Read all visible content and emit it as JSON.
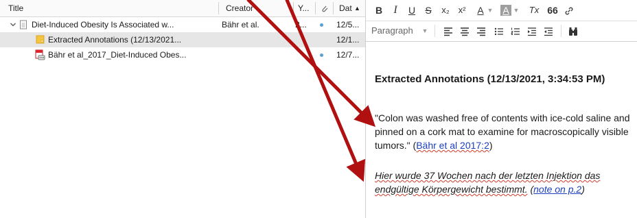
{
  "columns": {
    "title": "Title",
    "creator": "Creator",
    "year": "Y...",
    "date": "Dat"
  },
  "rows": [
    {
      "title": "Diet-Induced Obesity Is Associated w...",
      "creator": "Bähr et al.",
      "year": "2...",
      "date": "12/5..."
    },
    {
      "title": "Extracted Annotations (12/13/2021...",
      "creator": "",
      "year": "",
      "date": "12/1..."
    },
    {
      "title": "Bähr et al_2017_Diet-Induced Obes...",
      "creator": "",
      "year": "",
      "date": "12/7..."
    }
  ],
  "toolbar": {
    "bold": "B",
    "italic": "I",
    "underline": "U",
    "strikethrough": "S",
    "subscript": "x₂",
    "superscript": "x²",
    "text_color": "A",
    "highlight": "A",
    "clear_format": "Tx",
    "blockquote": "66",
    "paragraph_format": "Paragraph"
  },
  "editor": {
    "title": "Extracted Annotations (12/13/2021, 3:34:53 PM)",
    "quote_text": "\"Colon was washed free of contents with ice-cold saline and pinned on a cork mat to examine for macroscopically visible tumors.\"",
    "quote_citation": "Bähr et al 2017:2",
    "note_text": "Hier wurde 37 Wochen nach der letzten Injektion das endgültige Körpergewicht bestimmt.",
    "note_link": "note on p.2"
  },
  "colors": {
    "arrow": "#b01010",
    "link": "#1a3fbf",
    "selected_row": "#e6e6e6"
  }
}
